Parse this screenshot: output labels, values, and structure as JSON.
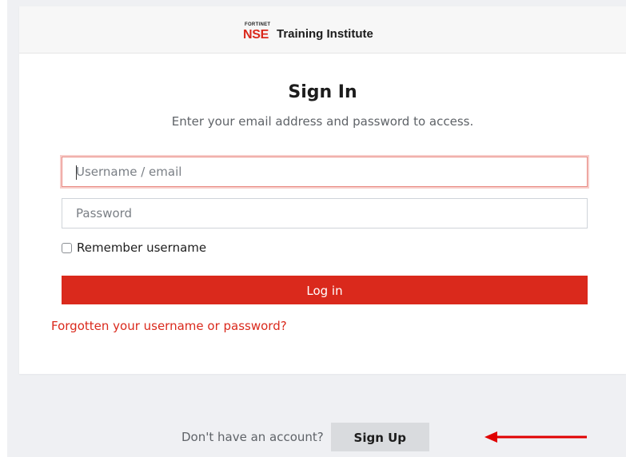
{
  "header": {
    "logo_small": "FORTINET",
    "logo_nse": "NSE",
    "logo_text": "Training Institute"
  },
  "signin": {
    "title": "Sign In",
    "subtitle": "Enter your email address and password to access.",
    "username_placeholder": "Username / email",
    "password_placeholder": "Password",
    "remember_label": "Remember username",
    "login_label": "Log in",
    "forgot_label": "Forgotten your username or password?"
  },
  "signup": {
    "prompt": "Don't have an account?",
    "button_label": "Sign Up"
  },
  "colors": {
    "brand_red": "#da291c",
    "page_bg": "#eff0f3",
    "signup_button_bg": "#d9dbde",
    "annotation_arrow": "#e00000"
  },
  "annotation": {
    "icon": "red-arrow-left-icon"
  }
}
